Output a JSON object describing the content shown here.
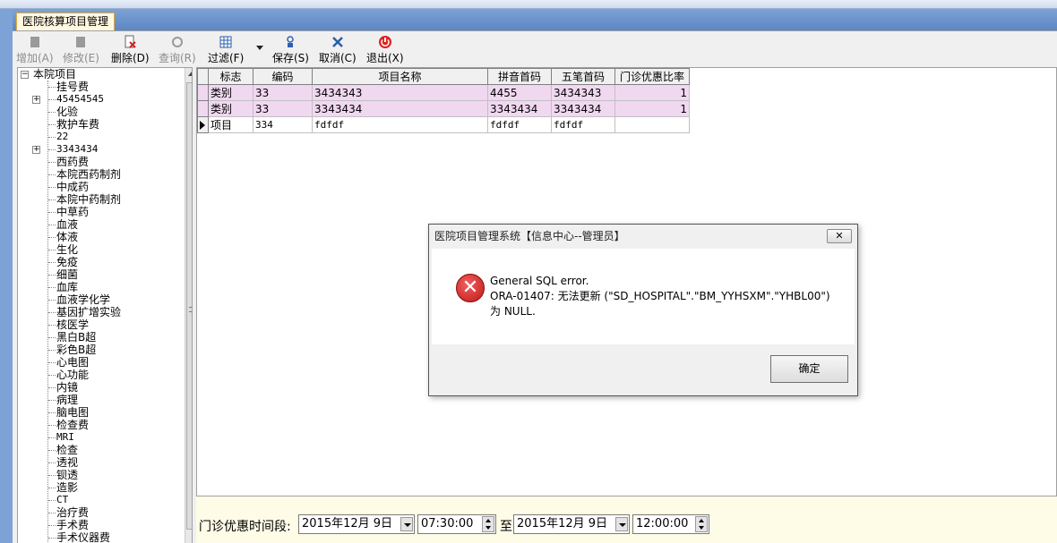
{
  "window": {
    "doc_tab": "医院核算项目管理"
  },
  "toolbar": {
    "add": "增加(A)",
    "edit": "修改(E)",
    "delete": "删除(D)",
    "query": "查询(R)",
    "filter": "过滤(F)",
    "save": "保存(S)",
    "cancel": "取消(C)",
    "exit": "退出(X)"
  },
  "tree": {
    "root": "本院项目",
    "items": [
      "挂号费",
      "45454545",
      "化验",
      "救护车费",
      "22",
      "3343434",
      "西药费",
      "本院西药制剂",
      "中成药",
      "本院中药制剂",
      "中草药",
      "血液",
      "体液",
      "生化",
      "免疫",
      "细菌",
      "血库",
      "血液学化学",
      "基因扩增实验",
      "核医学",
      "黑白B超",
      "彩色B超",
      "心电图",
      "心功能",
      "内镜",
      "病理",
      "脑电图",
      "检查费",
      "MRI",
      "检查",
      "透视",
      "钡透",
      "造影",
      "CT",
      "治疗费",
      "手术费",
      "手术仪器费"
    ]
  },
  "grid": {
    "columns": [
      "标志",
      "编码",
      "项目名称",
      "拼音首码",
      "五笔首码",
      "门诊优惠比率"
    ],
    "rows": [
      {
        "flag": "类别",
        "code": "33",
        "name": "3434343",
        "pinyin": "4455",
        "wubi": "3434343",
        "rate": "1"
      },
      {
        "flag": "类别",
        "code": "33",
        "name": "3343434",
        "pinyin": "3343434",
        "wubi": "3343434",
        "rate": "1"
      },
      {
        "flag": "项目",
        "code": "334",
        "name": "fdfdf",
        "pinyin": "fdfdf",
        "wubi": "fdfdf",
        "rate": ""
      }
    ]
  },
  "bottom": {
    "label": "门诊优惠时间段:",
    "start_date": "2015年12月 9日",
    "start_time": "07:30:00",
    "to_label": "至",
    "end_date": "2015年12月 9日",
    "end_time": "12:00:00"
  },
  "dialog": {
    "title": "医院项目管理系统【信息中心--管理员】",
    "close_glyph": "✕",
    "line1": "General SQL error.",
    "line2": "ORA-01407: 无法更新 (\"SD_HOSPITAL\".\"BM_YYHSXM\".\"YHBL00\")",
    "line3": "为 NULL.",
    "ok": "确定"
  },
  "colors": {
    "highlight_row": "#f1d8f1",
    "bottom_bar": "#fefbe6",
    "error_red": "#c01818"
  }
}
